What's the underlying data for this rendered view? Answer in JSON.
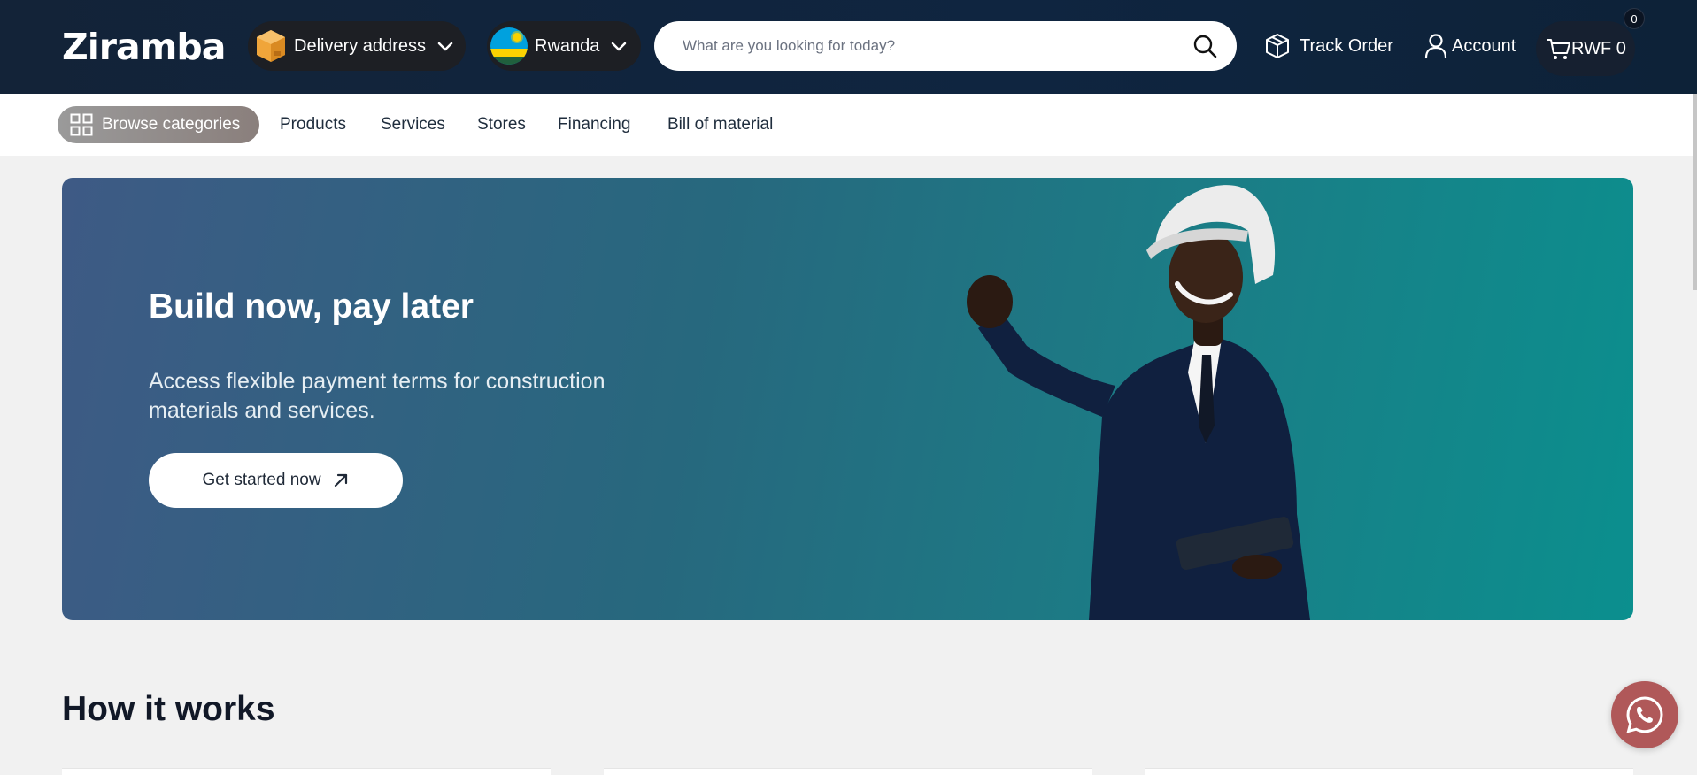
{
  "header": {
    "logo_text": "Ziramba",
    "delivery_label": "Delivery address",
    "country_label": "Rwanda",
    "search_placeholder": "What are you looking for today?",
    "track_order_label": "Track Order",
    "account_label": "Account",
    "cart_label": "RWF 0",
    "cart_count": "0"
  },
  "nav": {
    "browse_label": "Browse categories",
    "items": [
      "Products",
      "Services",
      "Stores",
      "Financing",
      "Bill of material"
    ]
  },
  "hero": {
    "title": "Build now, pay later",
    "subtitle": "Access flexible payment terms for construction materials and services.",
    "cta_label": "Get started now"
  },
  "how_it_works": {
    "title": "How it works"
  },
  "colors": {
    "header_bg": "#132338",
    "hero_start": "#3e5a85",
    "hero_end": "#0b8f8e",
    "whatsapp_bg": "#b05859"
  },
  "icons": [
    "package-icon",
    "chevron-down-icon",
    "rwanda-flag-icon",
    "search-icon",
    "box-icon",
    "user-icon",
    "cart-icon",
    "grid-icon",
    "arrow-up-right-icon",
    "whatsapp-icon"
  ]
}
